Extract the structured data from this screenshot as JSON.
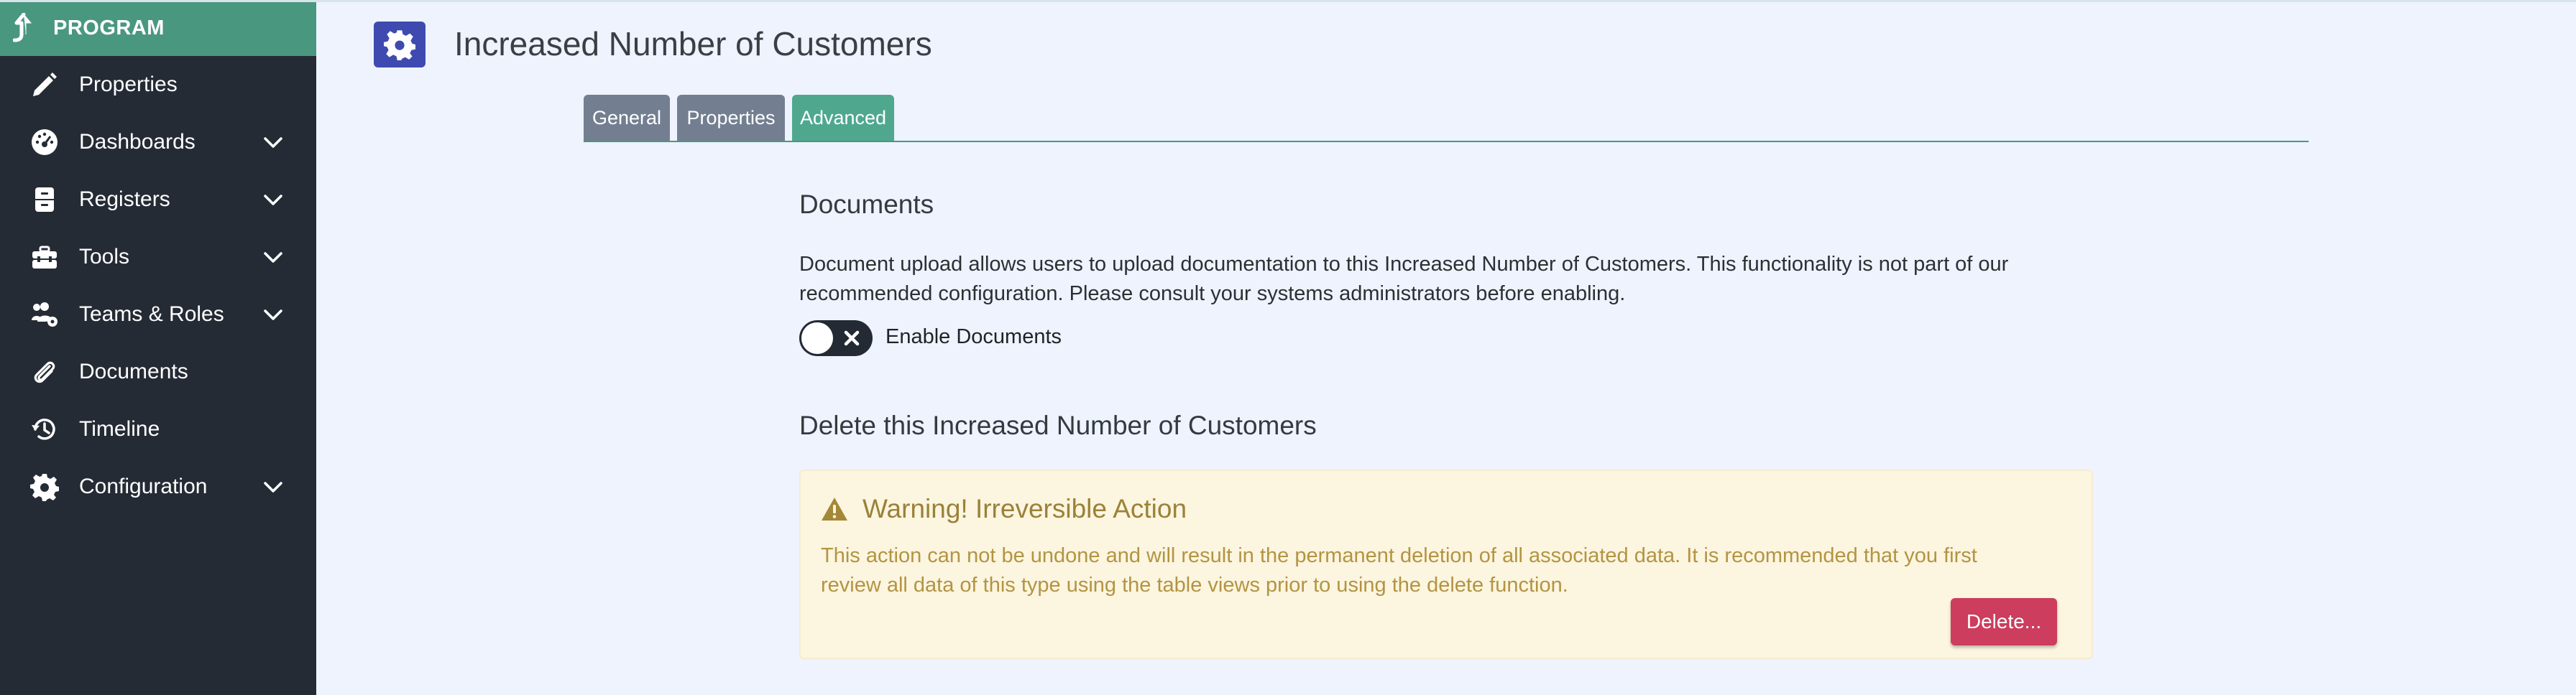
{
  "sidebar": {
    "header": "PROGRAM",
    "items": [
      {
        "label": "Properties",
        "icon": "pencil-icon",
        "expandable": false
      },
      {
        "label": "Dashboards",
        "icon": "gauge-icon",
        "expandable": true
      },
      {
        "label": "Registers",
        "icon": "file-cabinet-icon",
        "expandable": true
      },
      {
        "label": "Tools",
        "icon": "toolbox-icon",
        "expandable": true
      },
      {
        "label": "Teams & Roles",
        "icon": "users-gear-icon",
        "expandable": true
      },
      {
        "label": "Documents",
        "icon": "paperclip-icon",
        "expandable": false
      },
      {
        "label": "Timeline",
        "icon": "history-icon",
        "expandable": false
      },
      {
        "label": "Configuration",
        "icon": "gear-icon",
        "expandable": true
      }
    ]
  },
  "page": {
    "title": "Increased Number of Customers",
    "icon": "gear-icon"
  },
  "tabs": [
    {
      "label": "General",
      "active": false
    },
    {
      "label": "Properties",
      "active": false
    },
    {
      "label": "Advanced",
      "active": true
    }
  ],
  "documents": {
    "heading": "Documents",
    "description_line1": "Document upload allows users to upload documentation to this Increased Number of Customers. This functionality is not part of our",
    "description_line2": "recommended configuration. Please consult your systems administrators before enabling.",
    "toggle_label": "Enable Documents",
    "enabled": false
  },
  "delete_section": {
    "heading": "Delete this Increased Number of Customers",
    "warning_title": "Warning! Irreversible Action",
    "warning_line1": "This action can not be undone and will result in the permanent deletion of all associated data. It is recommended that you first",
    "warning_line2": "review all data of this type using the table views prior to using the delete function.",
    "delete_button": "Delete..."
  },
  "colors": {
    "sidebar_bg": "#252b35",
    "sidebar_header": "#4a9780",
    "accent": "#4fa88e",
    "tab_inactive": "#737f91",
    "danger": "#cc3d5e",
    "warning_bg": "#fcf5df",
    "warning_text": "#b39443"
  }
}
